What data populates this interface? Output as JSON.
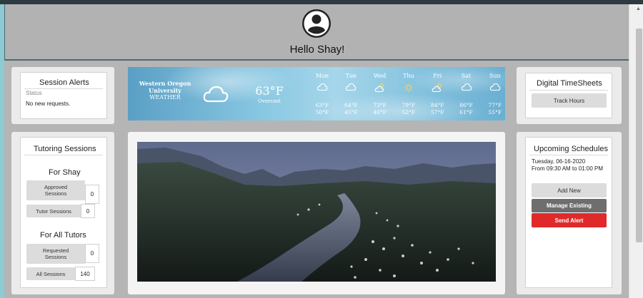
{
  "header": {
    "greeting": "Hello Shay!"
  },
  "session_alerts": {
    "title": "Session Alerts",
    "status_label": "Status",
    "message": "No new requests."
  },
  "weather": {
    "location": [
      "Western Oregon",
      "University",
      "WEATHER"
    ],
    "current_icon": "cloud-icon",
    "current_temp": "63°F",
    "current_condition": "Overcast",
    "forecast": [
      {
        "day": "Mon",
        "icon": "cloud-icon",
        "high": "63°F",
        "low": "50°F"
      },
      {
        "day": "Tue",
        "icon": "cloud-icon",
        "high": "64°F",
        "low": "45°F"
      },
      {
        "day": "Wed",
        "icon": "partly-sunny-icon",
        "high": "73°F",
        "low": "46°F"
      },
      {
        "day": "Thu",
        "icon": "sun-icon",
        "high": "79°F",
        "low": "52°F"
      },
      {
        "day": "Fri",
        "icon": "partly-sunny-icon",
        "high": "84°F",
        "low": "57°F"
      },
      {
        "day": "Sat",
        "icon": "cloud-icon",
        "high": "86°F",
        "low": "61°F"
      },
      {
        "day": "Sun",
        "icon": "cloud-icon",
        "high": "77°F",
        "low": "55°F"
      }
    ]
  },
  "timesheets": {
    "title": "Digital TimeSheets",
    "track_hours": "Track Hours"
  },
  "tutoring": {
    "title": "Tutoring Sessions",
    "for_user_heading": "For Shay",
    "approved_label": "Approved Sessions",
    "approved_value": "0",
    "tutor_label": "Tutor Sessions",
    "tutor_value": "0",
    "all_tutors_heading": "For All Tutors",
    "requested_label": "Requested Sessions",
    "requested_value": "0",
    "all_label": "All Sessions",
    "all_value": "140"
  },
  "schedules": {
    "title": "Upcoming Schedules",
    "date": "Tuesday, 06-16-2020",
    "time": "From 09:30 AM to 01:00 PM",
    "add_new": "Add New",
    "manage_existing": "Manage Existing",
    "send_alert": "Send Alert"
  },
  "colors": {
    "accent_red": "#e02a2a",
    "header_border": "#4a6a70",
    "page_bg": "#b5b5b5"
  }
}
